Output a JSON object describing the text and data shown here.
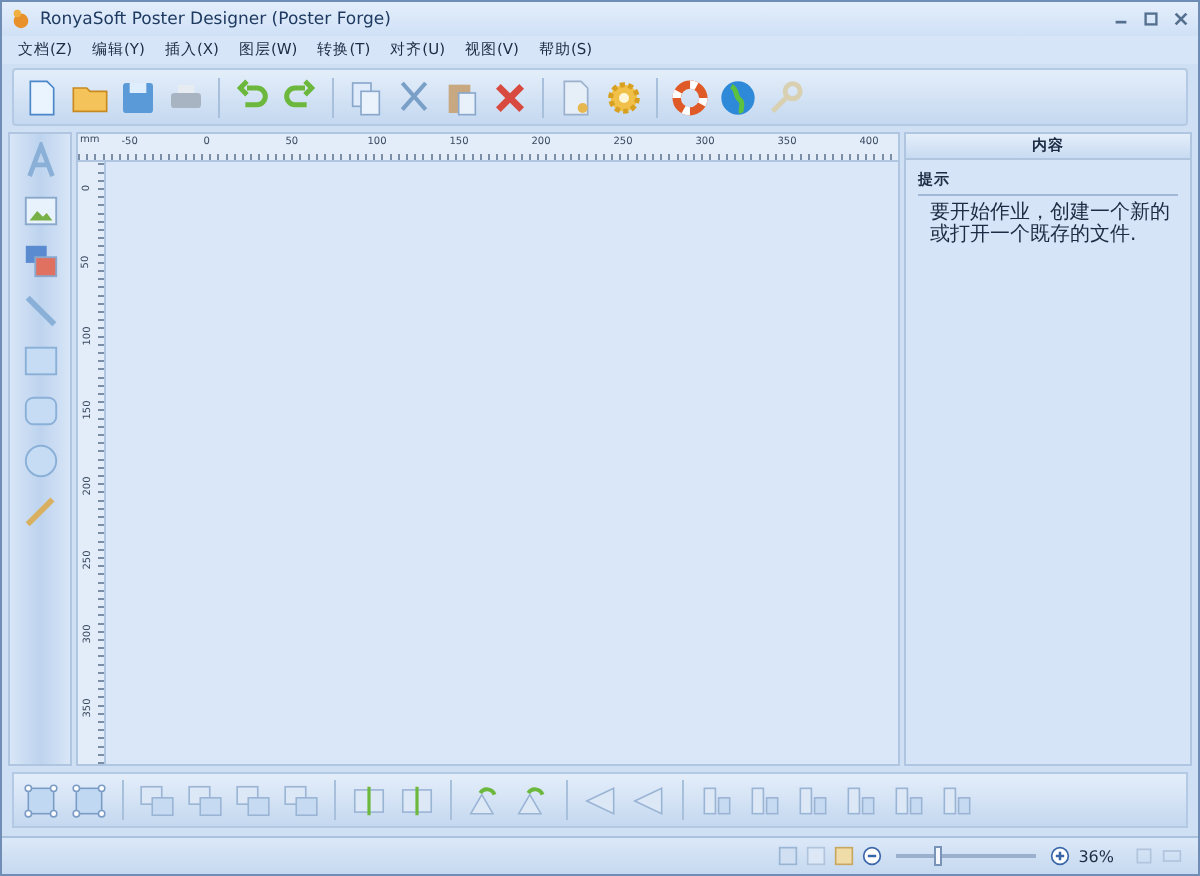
{
  "window": {
    "title": "RonyaSoft Poster Designer (Poster Forge)"
  },
  "menu": [
    "文档(Z)",
    "编辑(Y)",
    "插入(X)",
    "图层(W)",
    "转换(T)",
    "对齐(U)",
    "视图(V)",
    "帮助(S)"
  ],
  "ruler": {
    "unit": "mm",
    "horizontal_labels": [
      "-50",
      "0",
      "50",
      "100",
      "150",
      "200",
      "250",
      "300",
      "350",
      "400"
    ],
    "vertical_labels": [
      "0",
      "50",
      "100",
      "150",
      "200",
      "250",
      "300",
      "350"
    ]
  },
  "panel": {
    "title": "内容",
    "section": "提示",
    "text": "要开始作业，创建一个新的或打开一个既存的文件."
  },
  "status_bar": {
    "zoom": {
      "level": 0.3,
      "reading": "36%"
    }
  }
}
